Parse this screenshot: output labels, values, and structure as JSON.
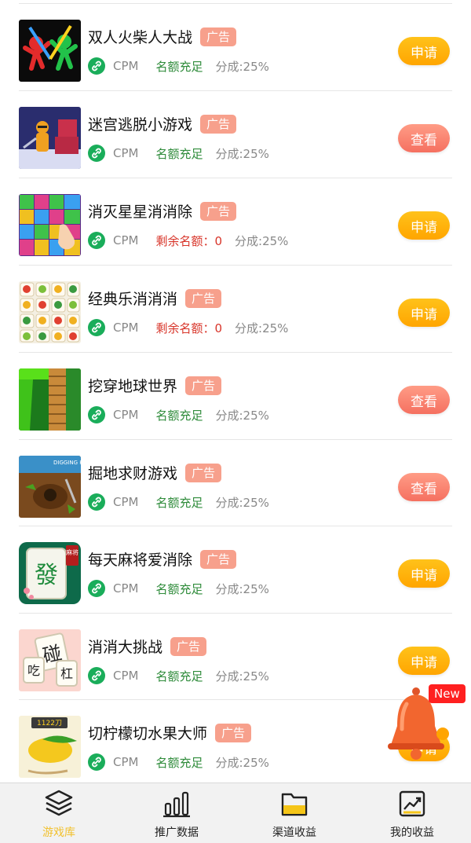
{
  "colors": {
    "apply": "#ffa500",
    "view": "#f57060",
    "ad_tag": "#f7a08c",
    "quota_ok": "#2e8b3a",
    "quota_zero": "#d8352a",
    "tab_active": "#f2c12e"
  },
  "games": [
    {
      "name": "双人火柴人大战",
      "tag": "广告",
      "type": "CPM",
      "quota": "名额充足",
      "quota_state": "ok",
      "share": "分成:25%",
      "action": "申请",
      "action_kind": "apply",
      "thumb": "stickman-fight-thumbnail"
    },
    {
      "name": "迷宫逃脱小游戏",
      "tag": "广告",
      "type": "CPM",
      "quota": "名额充足",
      "quota_state": "ok",
      "share": "分成:25%",
      "action": "查看",
      "action_kind": "view",
      "thumb": "maze-escape-thumbnail"
    },
    {
      "name": "消灭星星消消除",
      "tag": "广告",
      "type": "CPM",
      "quota": "剩余名额：0",
      "quota_state": "zero",
      "share": "分成:25%",
      "action": "申请",
      "action_kind": "apply",
      "thumb": "pop-star-thumbnail"
    },
    {
      "name": "经典乐消消消",
      "tag": "广告",
      "type": "CPM",
      "quota": "剩余名额：0",
      "quota_state": "zero",
      "share": "分成:25%",
      "action": "申请",
      "action_kind": "apply",
      "thumb": "fruit-match-thumbnail"
    },
    {
      "name": "挖穿地球世界",
      "tag": "广告",
      "type": "CPM",
      "quota": "名额充足",
      "quota_state": "ok",
      "share": "分成:25%",
      "action": "查看",
      "action_kind": "view",
      "thumb": "dig-earth-thumbnail"
    },
    {
      "name": "掘地求财游戏",
      "tag": "广告",
      "type": "CPM",
      "quota": "名额充足",
      "quota_state": "ok",
      "share": "分成:25%",
      "action": "查看",
      "action_kind": "view",
      "thumb": "dig-treasure-thumbnail"
    },
    {
      "name": "每天麻将爱消除",
      "tag": "广告",
      "type": "CPM",
      "quota": "名额充足",
      "quota_state": "ok",
      "share": "分成:25%",
      "action": "申请",
      "action_kind": "apply",
      "thumb": "mahjong-thumbnail"
    },
    {
      "name": "消消大挑战",
      "tag": "广告",
      "type": "CPM",
      "quota": "名额充足",
      "quota_state": "ok",
      "share": "分成:25%",
      "action": "申请",
      "action_kind": "apply",
      "thumb": "tile-challenge-thumbnail"
    },
    {
      "name": "切柠檬切水果大师",
      "tag": "广告",
      "type": "CPM",
      "quota": "名额充足",
      "quota_state": "ok",
      "share": "分成:25%",
      "action": "申请",
      "action_kind": "apply",
      "thumb": "cut-lemon-thumbnail"
    }
  ],
  "thumb_text": {
    "dig_treasure": "DIGGING HOL",
    "mahjong_tile": "發",
    "mahjong_badge": "麻将",
    "tile_big": "碰",
    "tile_a": "吃",
    "tile_b": "杠",
    "lemon_counter": "1122刀"
  },
  "floating": {
    "badge": "New",
    "icon": "bell-icon"
  },
  "tabbar": {
    "tabs": [
      {
        "label": "游戏库",
        "icon": "layers-icon",
        "active": true
      },
      {
        "label": "推广数据",
        "icon": "bar-chart-icon",
        "active": false
      },
      {
        "label": "渠道收益",
        "icon": "folder-icon",
        "active": false
      },
      {
        "label": "我的收益",
        "icon": "trend-chart-icon",
        "active": false
      }
    ]
  }
}
